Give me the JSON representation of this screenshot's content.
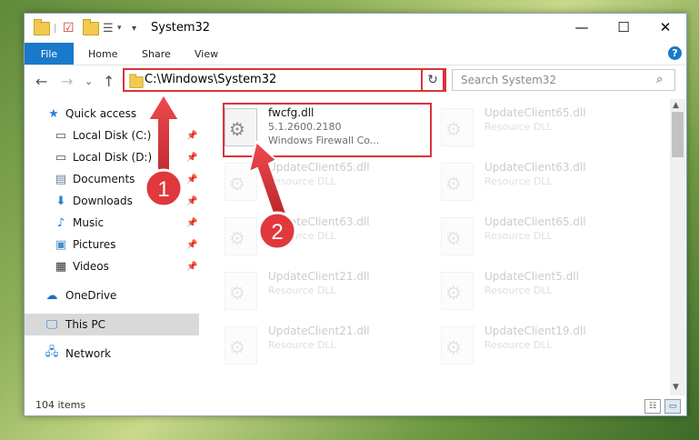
{
  "window": {
    "title": "System32",
    "controls": {
      "minimize": "—",
      "maximize": "☐",
      "close": "✕"
    }
  },
  "ribbon": {
    "tabs": [
      "File",
      "Home",
      "Share",
      "View"
    ],
    "help": "?"
  },
  "navigation": {
    "back": "←",
    "forward": "→",
    "recent": "⌄",
    "up": "↑",
    "address": "C:\\Windows\\System32",
    "refresh": "↻",
    "search_placeholder": "Search System32"
  },
  "sidebar": {
    "items": [
      {
        "label": "Quick access",
        "icon": "star-icon"
      },
      {
        "label": "Local Disk (C:)",
        "icon": "drive-icon",
        "pinned": true
      },
      {
        "label": "Local Disk (D:)",
        "icon": "drive-icon",
        "pinned": true
      },
      {
        "label": "Documents",
        "icon": "document-icon",
        "pinned": true
      },
      {
        "label": "Downloads",
        "icon": "download-icon",
        "pinned": true
      },
      {
        "label": "Music",
        "icon": "music-icon",
        "pinned": true
      },
      {
        "label": "Pictures",
        "icon": "picture-icon",
        "pinned": true
      },
      {
        "label": "Videos",
        "icon": "video-icon",
        "pinned": true
      },
      {
        "label": "OneDrive",
        "icon": "cloud-icon"
      },
      {
        "label": "This PC",
        "icon": "computer-icon",
        "selected": true
      },
      {
        "label": "Network",
        "icon": "network-icon"
      }
    ]
  },
  "files": [
    {
      "name": "fwcfg.dll",
      "line1": "5.1.2600.2180",
      "line2": "Windows Firewall Co...",
      "highlighted": true
    },
    {
      "name": "UpdateClient65.dll",
      "line1": "Resource DLL"
    },
    {
      "name": "UpdateClient65.dll",
      "line1": "Resource DLL"
    },
    {
      "name": "UpdateClient63.dll",
      "line1": "Resource DLL"
    },
    {
      "name": "UpdateClient63.dll",
      "line1": "Resource DLL"
    },
    {
      "name": "UpdateClient65.dll",
      "line1": "Resource DLL"
    },
    {
      "name": "UpdateClient21.dll",
      "line1": "Resource DLL"
    },
    {
      "name": "UpdateClient5.dll",
      "line1": "Resource DLL"
    },
    {
      "name": "UpdateClient21.dll",
      "line1": "Resource DLL"
    },
    {
      "name": "UpdateClient19.dll",
      "line1": "Resource DLL"
    }
  ],
  "status": {
    "count": "104 items"
  },
  "annotations": {
    "step1": "1",
    "step2": "2"
  },
  "colors": {
    "accent": "#1979ca",
    "highlight": "#d9343a",
    "callout": "#e0383c"
  }
}
